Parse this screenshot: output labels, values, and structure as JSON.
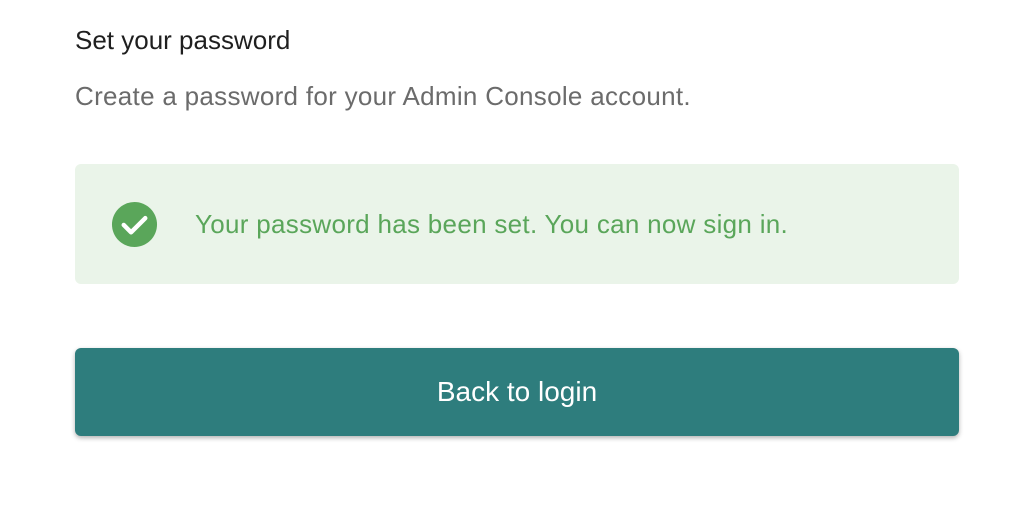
{
  "header": {
    "title": "Set your password",
    "subtitle": "Create a password for your Admin Console account."
  },
  "alert": {
    "icon": "check-circle-icon",
    "message": "Your password has been set. You can now sign in.",
    "text_color": "#5aa65a",
    "background_color": "#eaf4e9",
    "icon_color": "#5aa65a"
  },
  "actions": {
    "back_label": "Back to login",
    "button_color": "#2e7d7d"
  }
}
